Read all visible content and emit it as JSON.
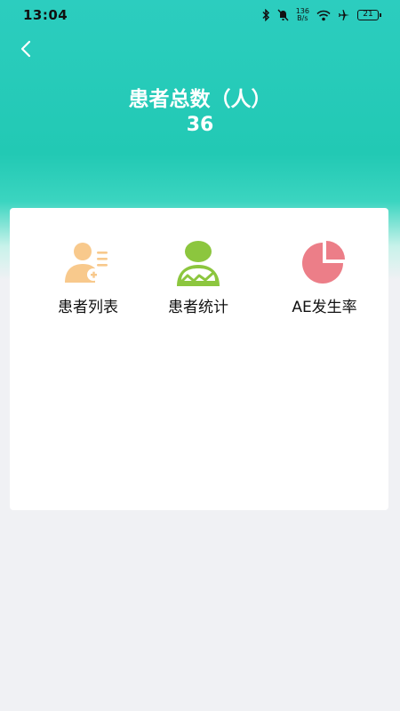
{
  "status_bar": {
    "time": "13:04",
    "net_speed_value": "136",
    "net_speed_unit": "B/s",
    "battery": "21",
    "icons": [
      "bluetooth-icon",
      "mute-icon",
      "wifi-icon",
      "airplane-icon",
      "battery-icon"
    ]
  },
  "header": {
    "title": "患者总数（人）",
    "count": "36",
    "back_icon": "chevron-left-icon"
  },
  "menu": {
    "items": [
      {
        "label": "患者列表",
        "icon": "patient-list-icon",
        "color": "#f8c98c"
      },
      {
        "label": "患者统计",
        "icon": "patient-stats-icon",
        "color": "#8cc63e"
      },
      {
        "label": "AE发生率",
        "icon": "pie-chart-icon",
        "color": "#ec7e88"
      }
    ]
  },
  "colors": {
    "header_gradient_top": "#2ccdbf",
    "background": "#f0f1f4",
    "card": "#ffffff"
  }
}
